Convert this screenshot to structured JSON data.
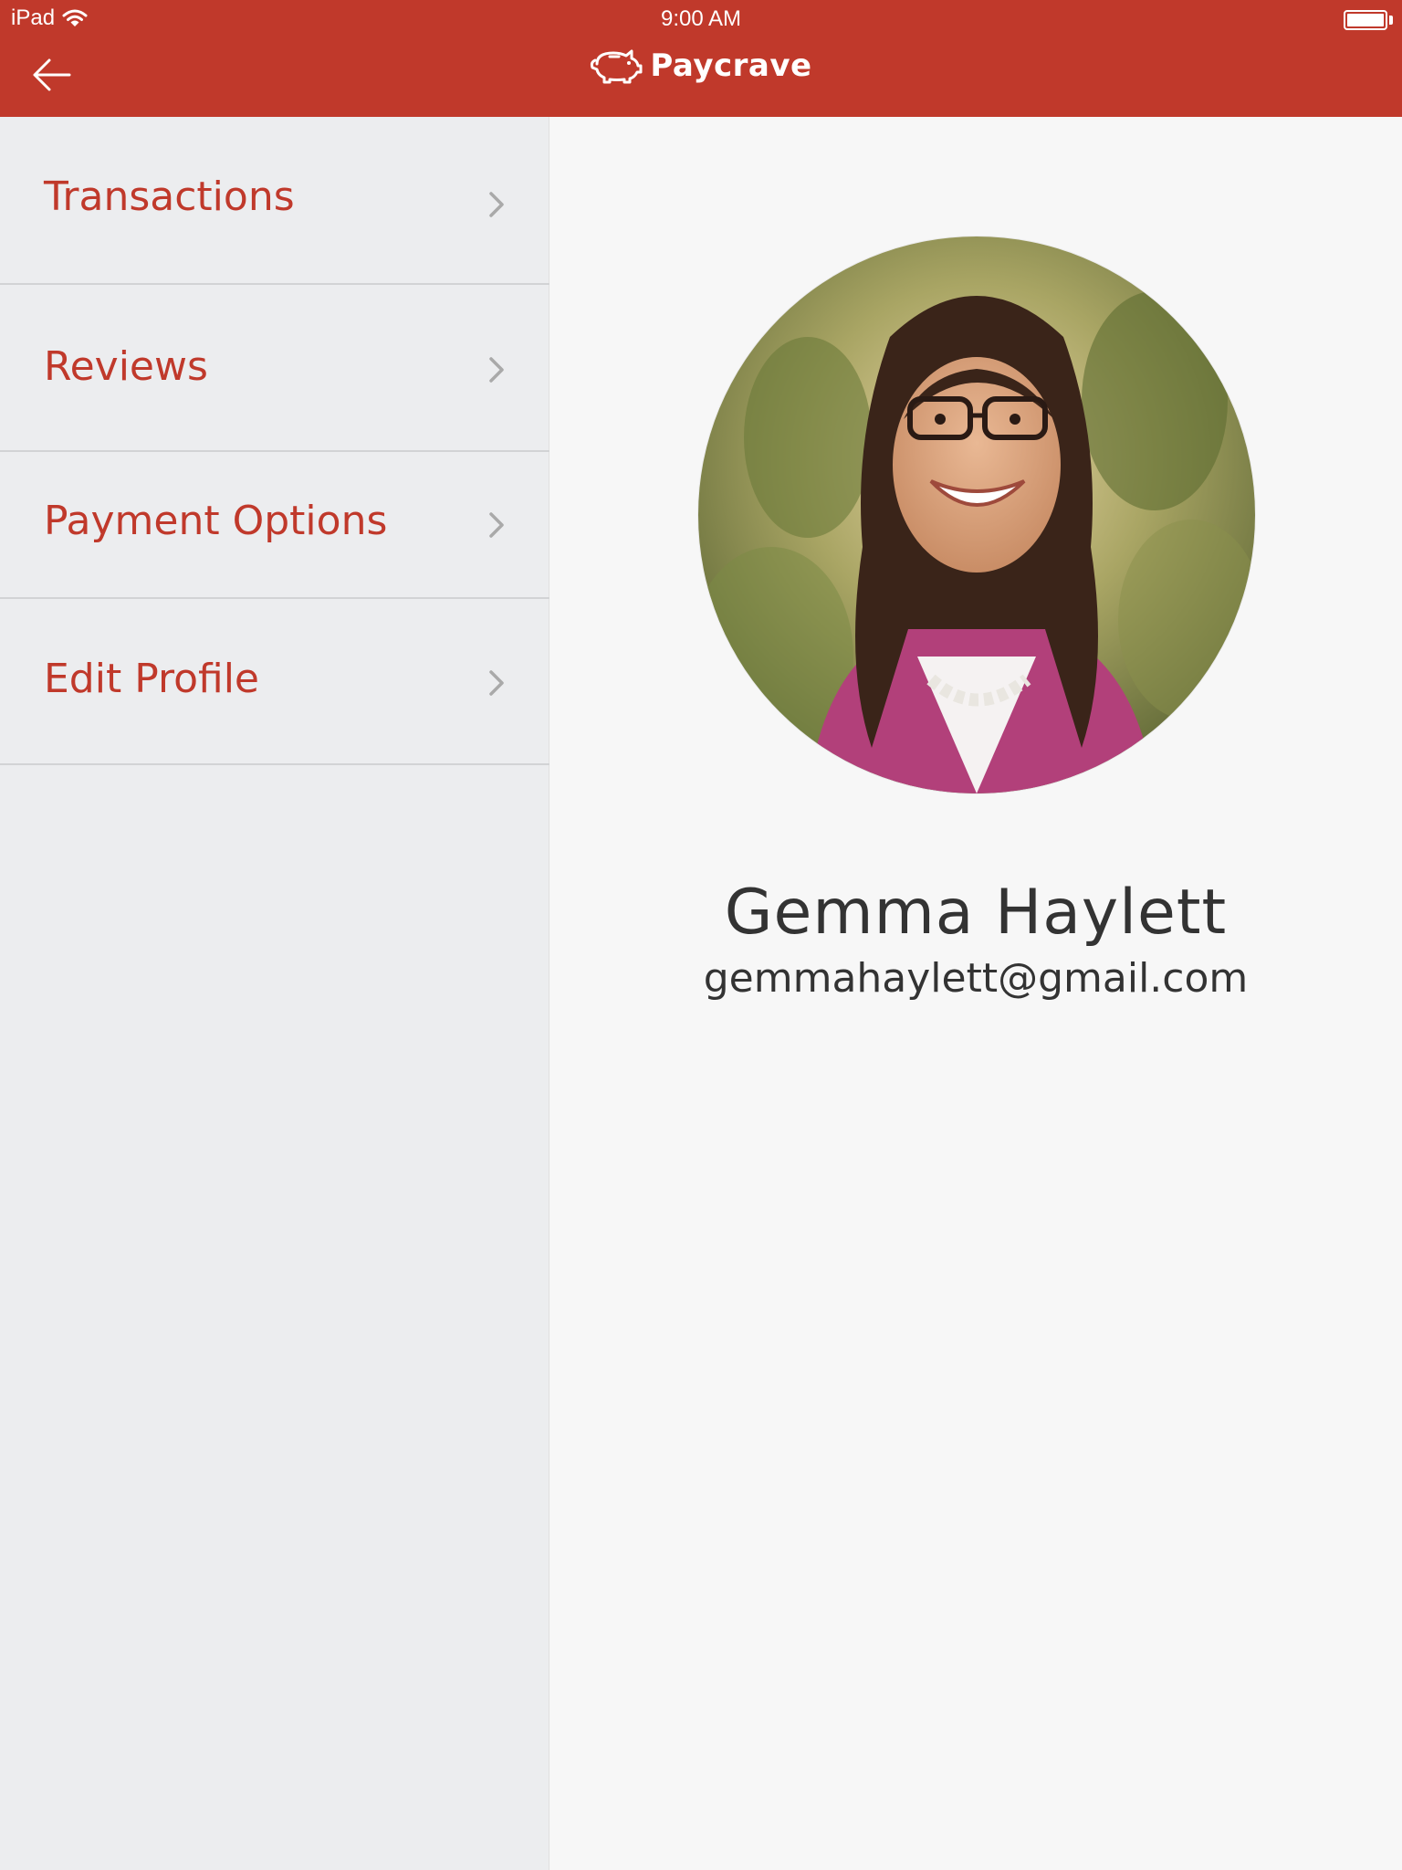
{
  "status_bar": {
    "device": "iPad",
    "time": "9:00 AM"
  },
  "header": {
    "app_name": "Paycrave",
    "back_icon": "arrow-left-icon",
    "logo_icon": "piggy-bank-icon",
    "background_color": "#c0392b"
  },
  "sidebar": {
    "items": [
      {
        "label": "Transactions",
        "icon": "chevron-right-icon"
      },
      {
        "label": "Reviews",
        "icon": "chevron-right-icon"
      },
      {
        "label": "Payment Options",
        "icon": "chevron-right-icon"
      },
      {
        "label": "Edit Profile",
        "icon": "chevron-right-icon"
      }
    ],
    "accent_color": "#c0392b"
  },
  "profile": {
    "name": "Gemma Haylett",
    "email": "gemmahaylett@gmail.com"
  }
}
